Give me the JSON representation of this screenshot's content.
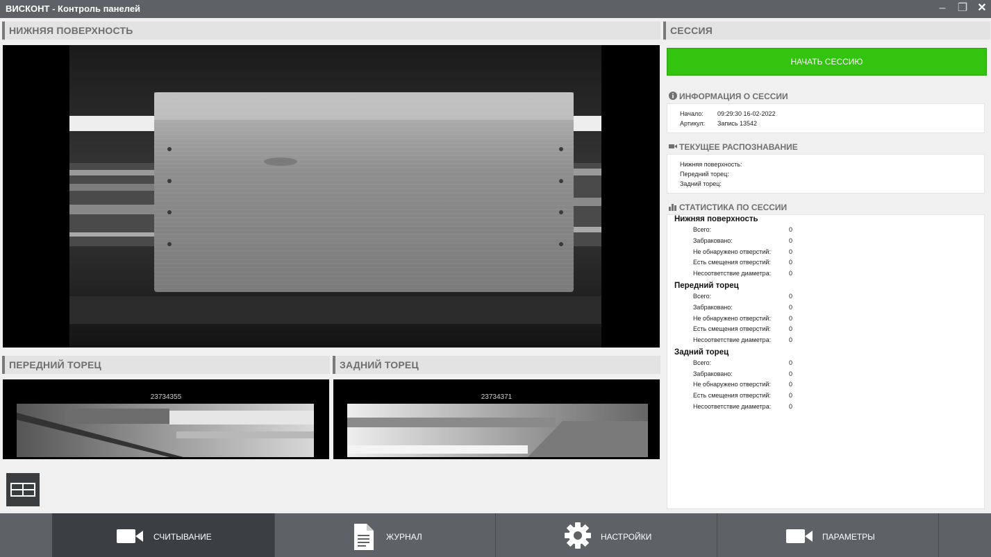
{
  "window": {
    "title": "ВИСКОНТ - Контроль панелей",
    "minimize": "–",
    "restore": "❐",
    "close": "✕"
  },
  "sections": {
    "bottom_surface": "НИЖНЯЯ ПОВЕРХНОСТЬ",
    "front_end": "ПЕРЕДНИЙ ТОРЕЦ",
    "back_end": "ЗАДНИЙ ТОРЕЦ",
    "session": "СЕССИЯ"
  },
  "cameras": {
    "front_id": "23734355",
    "back_id": "23734371"
  },
  "session": {
    "start_button": "НАЧАТЬ СЕССИЮ",
    "info_title": "ИНФОРМАЦИЯ О СЕССИИ",
    "info": [
      {
        "label": "Начало:",
        "value": "09:29:30 16-02-2022"
      },
      {
        "label": "Артикул:",
        "value": "Запись 13542"
      }
    ],
    "recognition_title": "ТЕКУЩЕЕ РАСПОЗНАВАНИЕ",
    "recognition": [
      "Нижняя поверхность:",
      "Передний торец:",
      "Задний торец:"
    ],
    "stats_title": "СТАТИСТИКА ПО СЕССИИ",
    "stats": [
      {
        "group": "Нижняя поверхность",
        "rows": [
          {
            "label": "Всего:",
            "value": "0"
          },
          {
            "label": "Забраковано:",
            "value": "0"
          },
          {
            "label": "Не обнаружено отверстий:",
            "value": "0"
          },
          {
            "label": "Есть смещения отверстий:",
            "value": "0"
          },
          {
            "label": "Несоответствие диаметра:",
            "value": "0"
          }
        ]
      },
      {
        "group": "Передний торец",
        "rows": [
          {
            "label": "Всего:",
            "value": "0"
          },
          {
            "label": "Забраковано:",
            "value": "0"
          },
          {
            "label": "Не обнаружено отверстий:",
            "value": "0"
          },
          {
            "label": "Есть смещения отверстий:",
            "value": "0"
          },
          {
            "label": "Несоответствие диаметра:",
            "value": "0"
          }
        ]
      },
      {
        "group": "Задний торец",
        "rows": [
          {
            "label": "Всего:",
            "value": "0"
          },
          {
            "label": "Забраковано:",
            "value": "0"
          },
          {
            "label": "Не обнаружено отверстий:",
            "value": "0"
          },
          {
            "label": "Есть смещения отверстий:",
            "value": "0"
          },
          {
            "label": "Несоответствие диаметра:",
            "value": "0"
          }
        ]
      }
    ]
  },
  "nav": [
    {
      "label": "СЧИТЫВАНИЕ",
      "icon": "video-camera-icon",
      "active": true
    },
    {
      "label": "ЖУРНАЛ",
      "icon": "document-icon",
      "active": false
    },
    {
      "label": "НАСТРОЙКИ",
      "icon": "gear-icon",
      "active": false
    },
    {
      "label": "ПАРАМЕТРЫ",
      "icon": "video-camera-icon",
      "active": false
    }
  ],
  "colors": {
    "accent_green": "#33c40f",
    "bar_dark": "#5e6266",
    "active_nav": "#3b3e42"
  }
}
